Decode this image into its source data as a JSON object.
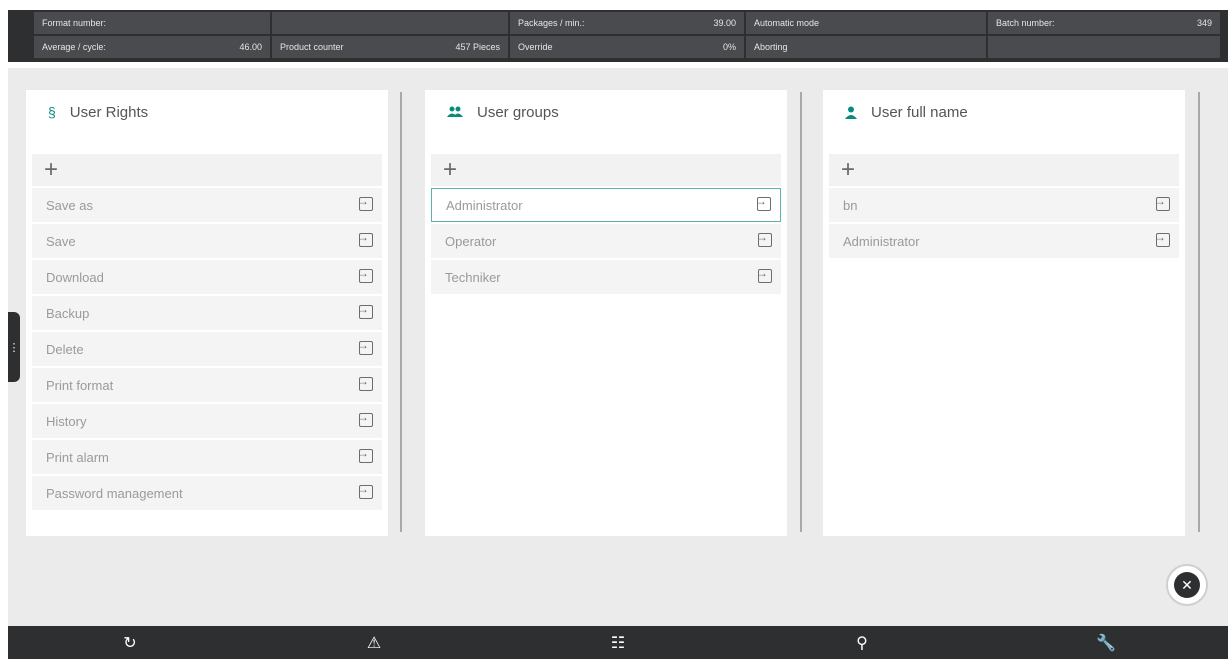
{
  "status": {
    "row1": [
      {
        "label": "Format number:",
        "value": ""
      },
      {
        "label": "",
        "value": ""
      },
      {
        "label": "Packages / min.:",
        "value": "39.00"
      },
      {
        "label": "Automatic mode",
        "value": ""
      },
      {
        "label": "Batch number:",
        "value": "349"
      }
    ],
    "row2": [
      {
        "label": "Average / cycle:",
        "value": "46.00"
      },
      {
        "label": "Product counter",
        "value": "457 Pieces"
      },
      {
        "label": "Override",
        "value": "0%"
      },
      {
        "label": "Aborting",
        "value": ""
      },
      {
        "label": "",
        "value": ""
      }
    ]
  },
  "panels": {
    "rights": {
      "title": "User Rights",
      "icon": "section-icon",
      "add": "+",
      "items": [
        "Save as",
        "Save",
        "Download",
        "Backup",
        "Delete",
        "Print format",
        "History",
        "Print alarm",
        "Password management"
      ]
    },
    "groups": {
      "title": "User groups",
      "icon": "users-icon",
      "add": "+",
      "items": [
        "Administrator",
        "Operator",
        "Techniker"
      ],
      "selected_index": 0
    },
    "fullname": {
      "title": "User full name",
      "icon": "user-icon",
      "add": "+",
      "items": [
        "bn",
        "Administrator"
      ]
    }
  },
  "side_handle": "⋮",
  "close_button": "✕",
  "bottom_nav": [
    {
      "name": "refresh-icon",
      "glyph": "↻"
    },
    {
      "name": "warning-icon",
      "glyph": "⚠"
    },
    {
      "name": "sliders-icon",
      "glyph": "☷"
    },
    {
      "name": "user-search-icon",
      "glyph": "⚲"
    },
    {
      "name": "wrench-icon",
      "glyph": "🔧"
    }
  ],
  "colors": {
    "accent": "#0a8c7d",
    "bar_dark": "#2e2f31",
    "cell_bg": "#4a4b4e",
    "workspace_bg": "#ebebeb"
  }
}
